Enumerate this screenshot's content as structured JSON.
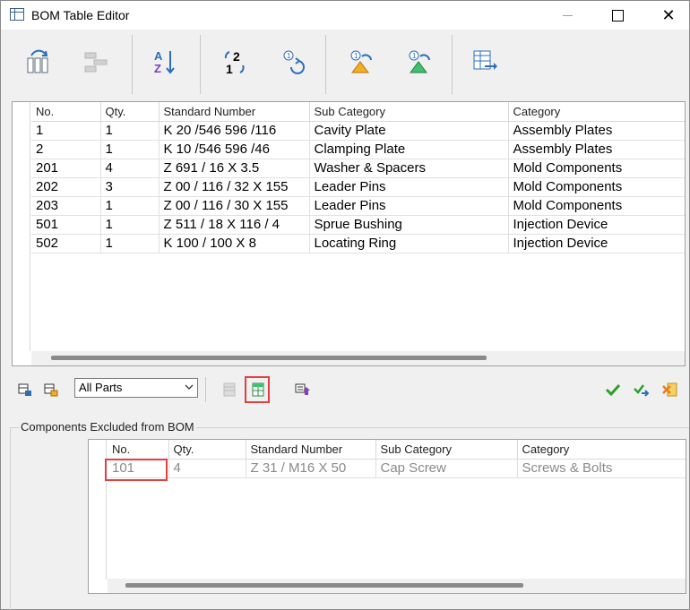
{
  "window": {
    "title": "BOM Table Editor"
  },
  "toolbar": {
    "icons": [
      "bom-columns-icon",
      "bom-tree-icon",
      "sort-az-icon",
      "renumber-icon",
      "refresh-numbering-icon",
      "find-previous-icon",
      "find-next-icon",
      "export-table-icon"
    ]
  },
  "bom_table": {
    "columns": [
      "No.",
      "Qty.",
      "Standard Number",
      "Sub Category",
      "Category"
    ],
    "rows": [
      [
        "1",
        "1",
        "K 20 /546 596 /116",
        "Cavity Plate",
        "Assembly Plates"
      ],
      [
        "2",
        "1",
        "K 10 /546 596 /46",
        "Clamping Plate",
        "Assembly Plates"
      ],
      [
        "201",
        "4",
        "Z 691 / 16 X 3.5",
        "Washer & Spacers",
        "Mold Components"
      ],
      [
        "202",
        "3",
        "Z 00 / 116 / 32 X 155",
        "Leader Pins",
        "Mold Components"
      ],
      [
        "203",
        "1",
        "Z 00 / 116 / 30 X 155",
        "Leader Pins",
        "Mold Components"
      ],
      [
        "501",
        "1",
        "Z 511 / 18 X 116 / 4",
        "Sprue Bushing",
        "Injection Device"
      ],
      [
        "502",
        "1",
        "K 100 / 100 X 8",
        "Locating Ring",
        "Injection Device"
      ]
    ]
  },
  "filter": {
    "selected": "All Parts"
  },
  "excluded": {
    "label": "Components Excluded from BOM",
    "columns": [
      "No.",
      "Qty.",
      "Standard Number",
      "Sub Category",
      "Category"
    ],
    "rows": [
      [
        "101",
        "4",
        "Z 31 / M16 X 50",
        "Cap Screw",
        "Screws & Bolts"
      ]
    ]
  },
  "colors": {
    "highlight": "#e04040",
    "ok_green": "#2aa02a",
    "excluded_text": "#8a8a8a"
  }
}
